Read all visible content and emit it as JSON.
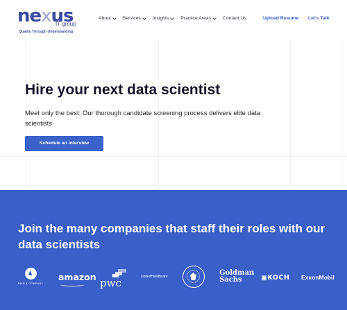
{
  "header": {
    "logo": {
      "word_pre": "ne",
      "word_x": "x",
      "word_post": "us",
      "sub": "IT group",
      "tagline": "Quality Through Understanding"
    },
    "nav": [
      {
        "label": "About",
        "has_dropdown": true
      },
      {
        "label": "Services",
        "has_dropdown": true
      },
      {
        "label": "Insights",
        "has_dropdown": true
      },
      {
        "label": "Practice Areas",
        "has_dropdown": true
      },
      {
        "label": "Contact Us",
        "has_dropdown": false
      }
    ],
    "upload_resume": "Upload Resume",
    "lets_talk": "Let's Talk"
  },
  "hero": {
    "title": "Hire your next data scientist",
    "subtitle": "Meet only the best: Our thorough candidate screening process delivers elite data scientists",
    "cta": "Schedule an interview"
  },
  "clients": {
    "title": "Join the many companies that staff their roles with our data scientists",
    "logos": {
      "bain": "BAIN & COMPANY",
      "amazon": "amazon",
      "pwc": "pwc",
      "unitedhealth": "UnitedHealthcare",
      "goldman_line1": "Goldman",
      "goldman_line2": "Sachs",
      "koch": "KOCH",
      "exxon": "ExxonMobil"
    }
  },
  "colors": {
    "brand_blue": "#3a5fc8",
    "logo_navy": "#3b4aa0",
    "cta_blue": "#3a62c9"
  }
}
